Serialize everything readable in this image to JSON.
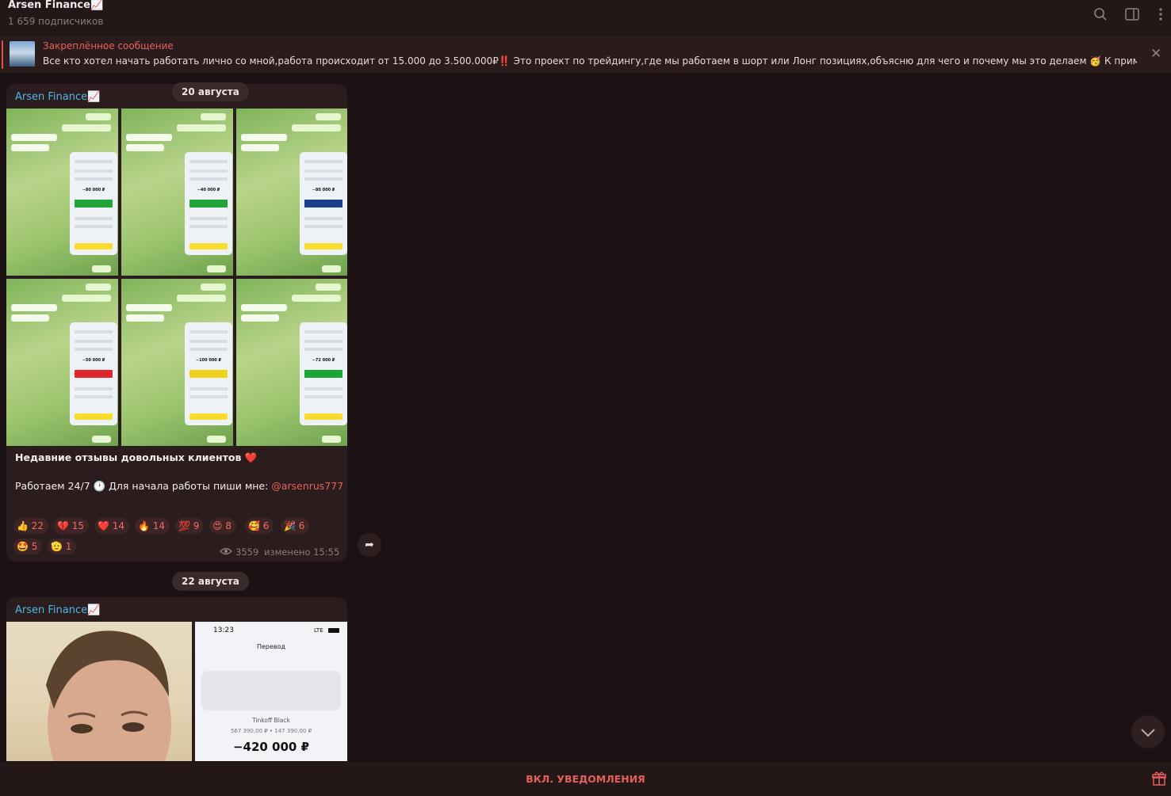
{
  "header": {
    "title": "Arsen Finance📈",
    "subscribers": "1 659 подписчиков",
    "icons": [
      "search-icon",
      "sidebar-toggle-icon",
      "more-icon"
    ]
  },
  "pinned": {
    "label": "Закреплённое сообщение",
    "text": "Все кто хотел начать работать лично со мной,работа происходит от 15.000 до 3.500.000₽‼️ Это проект по трейдингу,где мы работаем в шорт или Лонг позициях,объясню для чего и почему мы это делаем 🥳 К приме..."
  },
  "messages": [
    {
      "date": "20 августа",
      "sender": "Arsen Finance📈",
      "text_line1": "Недавние отзывы довольных клиентов ❤️",
      "text_line2_prefix": "Работаем 24/7 🕐 Для начала работы пиши мне: ",
      "mention": "@arsenrus777",
      "reactions": [
        {
          "emoji": "👍",
          "count": "22"
        },
        {
          "emoji": "💔",
          "count": "15"
        },
        {
          "emoji": "❤️",
          "count": "14"
        },
        {
          "emoji": "🔥",
          "count": "14"
        },
        {
          "emoji": "💯",
          "count": "9"
        },
        {
          "emoji": "😍",
          "count": "8"
        },
        {
          "emoji": "🥰",
          "count": "6"
        },
        {
          "emoji": "🎉",
          "count": "6"
        },
        {
          "emoji": "🤩",
          "count": "5"
        },
        {
          "emoji": "🫡",
          "count": "1"
        }
      ],
      "views": "3559",
      "edited": "изменено 15:55",
      "photos": [
        {
          "amount": "−80 000 ₽",
          "band": "#1fa537"
        },
        {
          "amount": "−40 000 ₽",
          "band": "#1fa537"
        },
        {
          "amount": "−80 000 ₽",
          "band": "#1c3f8c"
        },
        {
          "amount": "−50 000 ₽",
          "band": "#e0262b"
        },
        {
          "amount": "−100 000 ₽",
          "band": "#f0d21c"
        },
        {
          "amount": "−72 000 ₽",
          "band": "#1fa537"
        }
      ]
    },
    {
      "date": "22 августа",
      "sender": "Arsen Finance📈",
      "receipt": {
        "time": "13:23",
        "network": "LTE",
        "title": "Перевод",
        "card": "Tinkoff Black",
        "balance": "567 390,00 ₽  •  147 390,00 ₽",
        "amount": "−420 000 ₽"
      }
    }
  ],
  "bottom": {
    "notify_label": "ВКЛ. УВЕДОМЛЕНИЯ"
  },
  "colors": {
    "accent": "#e6605a",
    "sender": "#4fb6e6",
    "background": "#1d1213"
  }
}
